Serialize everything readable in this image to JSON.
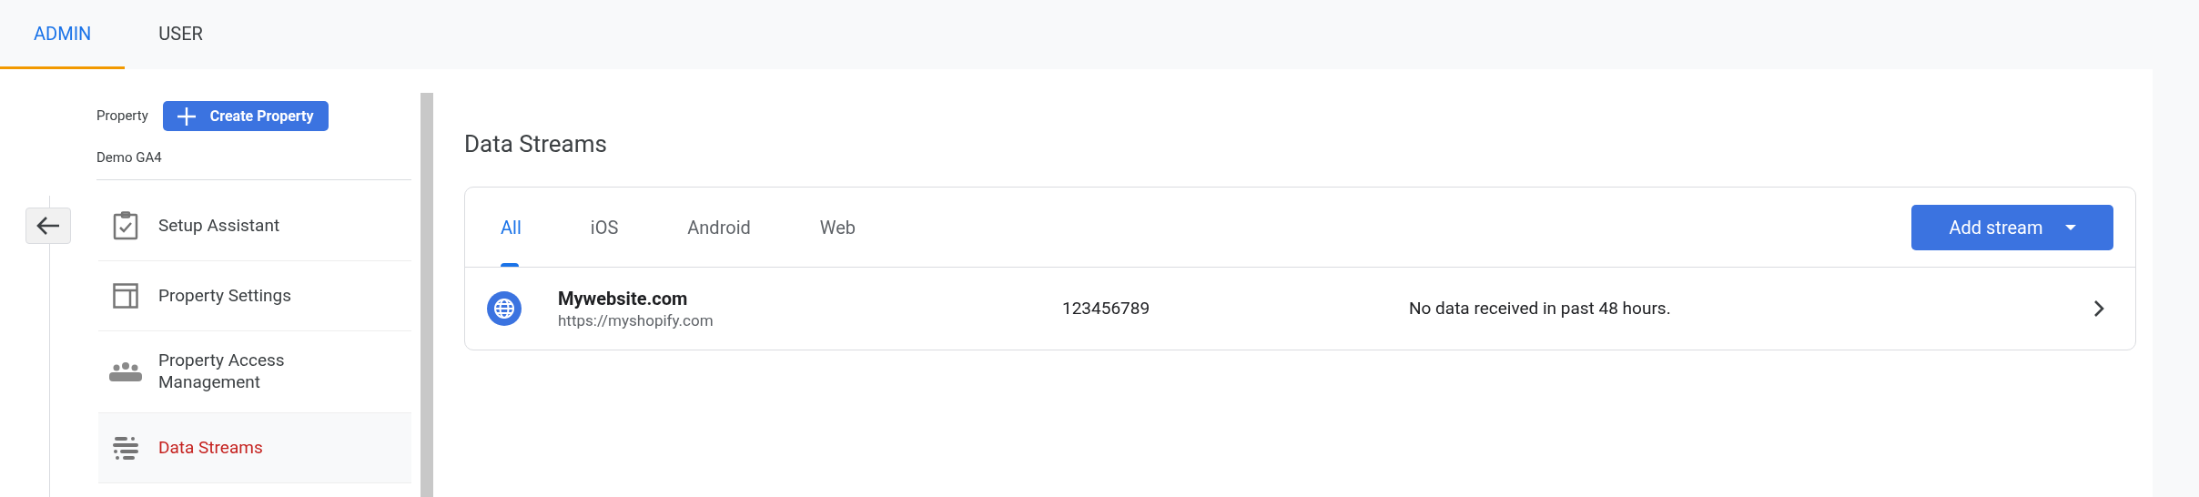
{
  "top_tabs": [
    {
      "label": "ADMIN",
      "selected": true
    },
    {
      "label": "USER",
      "selected": false
    }
  ],
  "sidebar": {
    "property_label": "Property",
    "create_button": "Create Property",
    "property_name": "Demo GA4",
    "items": [
      {
        "kind": "setup",
        "label": "Setup Assistant",
        "selected": false
      },
      {
        "kind": "settings",
        "label": "Property Settings",
        "selected": false
      },
      {
        "kind": "access",
        "label": "Property Access Management",
        "selected": false
      },
      {
        "kind": "streams",
        "label": "Data Streams",
        "selected": true
      }
    ]
  },
  "main": {
    "title": "Data Streams",
    "tabs": [
      {
        "label": "All",
        "selected": true
      },
      {
        "label": "iOS",
        "selected": false
      },
      {
        "label": "Android",
        "selected": false
      },
      {
        "label": "Web",
        "selected": false
      }
    ],
    "add_button": "Add stream",
    "streams": [
      {
        "name": "Mywebsite.com",
        "url": "https://myshopify.com",
        "id": "123456789",
        "status": "No data received in past 48 hours."
      }
    ]
  }
}
